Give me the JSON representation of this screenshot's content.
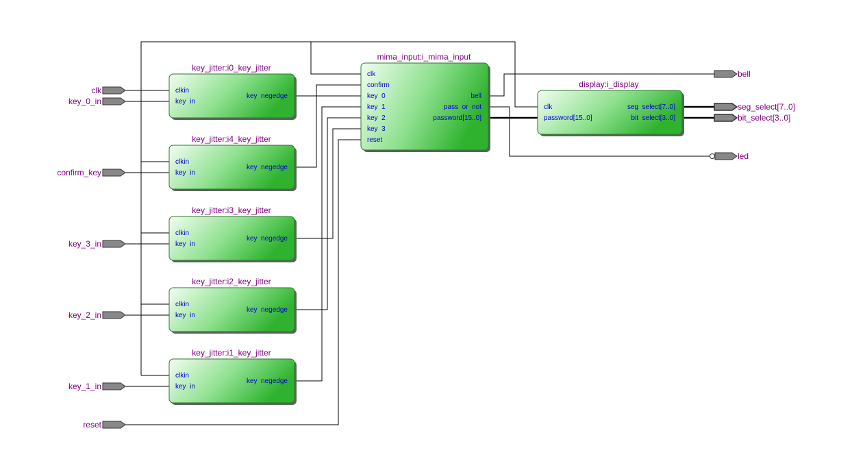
{
  "diagram": {
    "inputs": {
      "clk": "clk",
      "key_0_in": "key_0_in",
      "confirm_key": "confirm_key",
      "key_3_in": "key_3_in",
      "key_2_in": "key_2_in",
      "key_1_in": "key_1_in",
      "reset": "reset"
    },
    "outputs": {
      "bell": "bell",
      "seg_select": "seg_select[7..0]",
      "bit_select": "bit_select[3..0]",
      "led": "led"
    },
    "blocks": {
      "kj0": {
        "title": "key_jitter:i0_key_jitter",
        "clkin": "clkin",
        "key_in": "key  in",
        "key_negedge": "key  negedge"
      },
      "kj4": {
        "title": "key_jitter:i4_key_jitter",
        "clkin": "clkin",
        "key_in": "key  in",
        "key_negedge": "key  negedge"
      },
      "kj3": {
        "title": "key_jitter:i3_key_jitter",
        "clkin": "clkin",
        "key_in": "key  in",
        "key_negedge": "key  negedge"
      },
      "kj2": {
        "title": "key_jitter:i2_key_jitter",
        "clkin": "clkin",
        "key_in": "key  in",
        "key_negedge": "key  negedge"
      },
      "kj1": {
        "title": "key_jitter:i1_key_jitter",
        "clkin": "clkin",
        "key_in": "key  in",
        "key_negedge": "key  negedge"
      },
      "mima": {
        "title": "mima_input:i_mima_input",
        "clk": "clk",
        "confirm": "confirm",
        "key0": "key  0",
        "key1": "key  1",
        "key2": "key  2",
        "key3": "key  3",
        "reset": "reset",
        "bell": "bell",
        "pass_or_not": "pass  or  not",
        "password": "password[15..0]"
      },
      "display": {
        "title": "display:i_display",
        "clk": "clk",
        "password": "password[15..0]",
        "seg_select": "seg  select[7..0]",
        "bit_select": "bit  select[3..0]"
      }
    },
    "colors": {
      "wire": "#000000",
      "label": "#800080",
      "pin": "#0000cc",
      "block_start": "#e8f8e8",
      "block_end": "#33b633",
      "port": "#888888"
    }
  }
}
